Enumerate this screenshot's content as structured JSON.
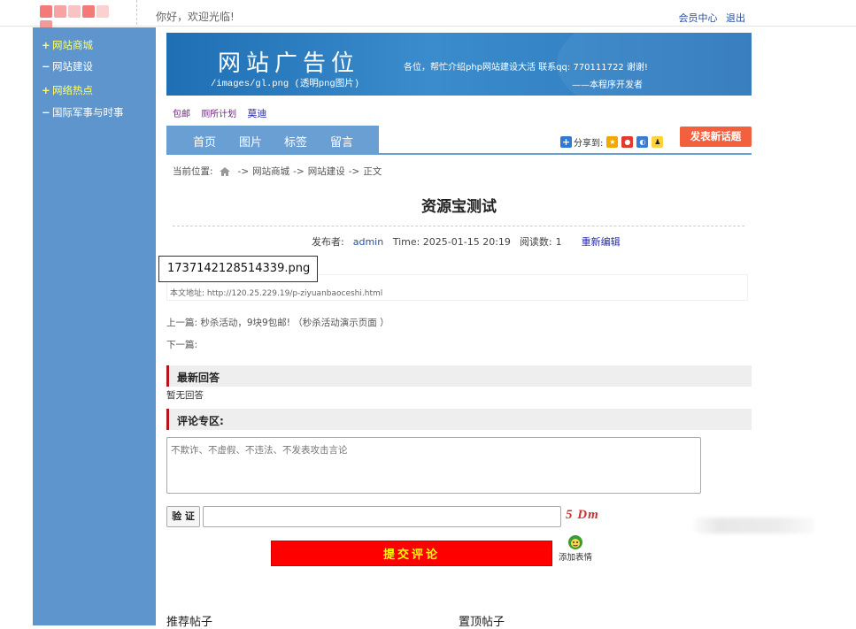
{
  "topbar": {
    "welcome": "你好，欢迎光临!",
    "member_center": "会员中心",
    "logout": "退出",
    "logo_colors": [
      "#f47a7a",
      "#f6a3a3",
      "#f9c3c3",
      "#f47a7a",
      "#fbd0d0",
      "#f39999"
    ]
  },
  "sidebar": {
    "items": [
      {
        "symbol": "+",
        "label": "网站商城",
        "highlight": true
      },
      {
        "symbol": "−",
        "label": "网站建设",
        "highlight": false
      },
      {
        "symbol": "+",
        "label": "网络热点",
        "highlight": true
      },
      {
        "symbol": "−",
        "label": "国际军事与时事",
        "highlight": false
      }
    ]
  },
  "banner": {
    "title": "网站广告位",
    "path": "/images/gl.png  (透明png图片)",
    "message": "各位，帮忙介绍php网站建设大活   联系qq: 770111722 谢谢!",
    "signature": "——本程序开发者"
  },
  "quick_links": [
    "包邮",
    "厕所计划",
    "莫迪"
  ],
  "nav": {
    "items": [
      "首页",
      "图片",
      "标签",
      "留言"
    ],
    "share_label": "分享到:",
    "post_button": "发表新话题"
  },
  "breadcrumb": {
    "prefix": "当前位置:",
    "sep": "->",
    "items": [
      "网站商城",
      "网站建设",
      "正文"
    ]
  },
  "article": {
    "title": "资源宝测试",
    "author_label": "发布者:",
    "author": "admin",
    "time": "Time: 2025-01-15 20:19",
    "reads_label": "阅读数:",
    "reads": "1",
    "edit": "重新编辑",
    "image_label": "1737142128514339.png",
    "address": "本文地址:  http://120.25.229.19/p-ziyuanbaoceshi.html",
    "prev": "上一篇: 秒杀活动，9块9包邮! （秒杀活动演示页面 ）",
    "next": "下一篇:"
  },
  "replies": {
    "heading": "最新回答",
    "empty": "暂无回答"
  },
  "comment": {
    "heading": "评论专区:",
    "placeholder": "不欺诈、不虚假、不违法、不发表攻击言论",
    "verify_button": "验 证",
    "captcha": "5 Dm",
    "submit": "提交评论",
    "emoji_label": "添加表情"
  },
  "bottom": {
    "recommended": "推荐帖子",
    "pinned": "置顶帖子"
  }
}
